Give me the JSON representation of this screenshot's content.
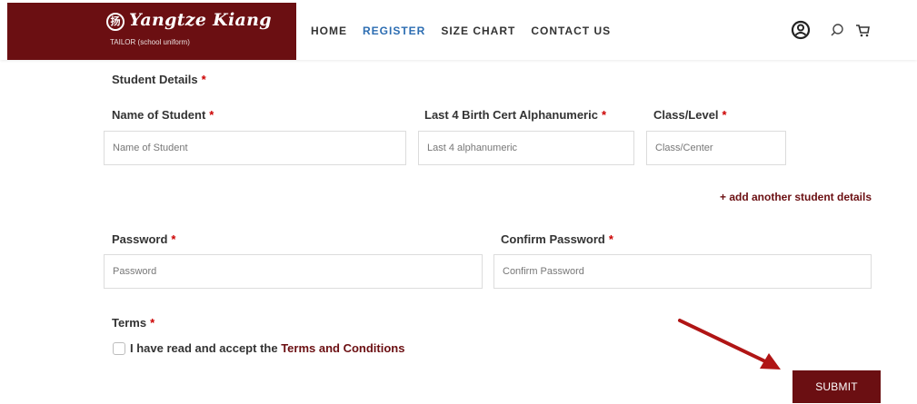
{
  "header": {
    "logo": {
      "title": "Yangtze Kiang",
      "subtitle": "TAILOR (school uniform)",
      "emblem": "扬"
    },
    "nav": [
      "HOME",
      "REGISTER",
      "SIZE CHART",
      "CONTACT US"
    ],
    "active_nav": "REGISTER",
    "icons": [
      "user-account-icon",
      "search-icon",
      "cart-icon"
    ]
  },
  "form": {
    "section_title": "Student Details",
    "required_mark": "*",
    "student": {
      "name": {
        "label": "Name of Student",
        "placeholder": "Name of Student",
        "value": ""
      },
      "birth_cert": {
        "label": "Last 4 Birth Cert Alphanumeric",
        "placeholder": "Last 4 alphanumeric",
        "value": ""
      },
      "class_level": {
        "label": "Class/Level",
        "placeholder": "Class/Center",
        "value": ""
      }
    },
    "add_student_link": "+ add another student details",
    "password": {
      "label": "Password",
      "placeholder": "Password",
      "value": ""
    },
    "confirm_password": {
      "label": "Confirm Password",
      "placeholder": "Confirm Password",
      "value": ""
    },
    "terms": {
      "label": "Terms",
      "checkbox_text": "I have read and accept the",
      "link_text": "Terms and Conditions",
      "checked": false
    },
    "submit_label": "SUBMIT"
  },
  "colors": {
    "brand": "#6b0f12",
    "nav_active": "#2c6db2",
    "required": "#cc0000",
    "annotation_arrow": "#b01515"
  }
}
